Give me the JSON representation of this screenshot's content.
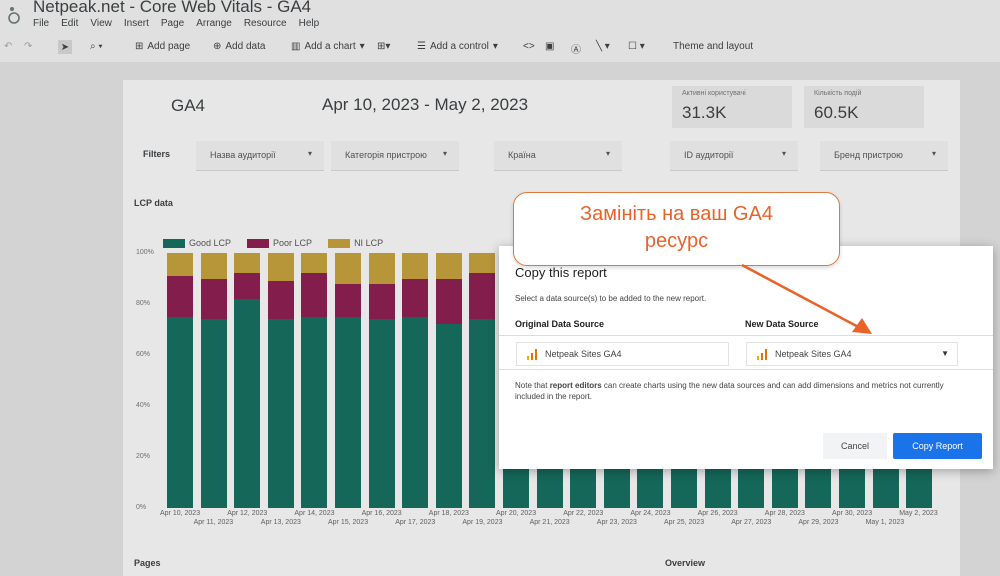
{
  "app": {
    "title": "Netpeak.net - Core Web Vitals - GA4",
    "menu": [
      "File",
      "Edit",
      "View",
      "Insert",
      "Page",
      "Arrange",
      "Resource",
      "Help"
    ]
  },
  "toolbar": {
    "add_page": "Add page",
    "add_data": "Add data",
    "add_chart": "Add a chart",
    "add_control": "Add a control",
    "theme_layout": "Theme and layout"
  },
  "report": {
    "ga4_label": "GA4",
    "date_range": "Apr 10, 2023 - May 2, 2023",
    "scorecards": [
      {
        "label": "Активні користувачі",
        "value": "31.3K"
      },
      {
        "label": "Кількість подій",
        "value": "60.5K"
      }
    ],
    "filters_label": "Filters",
    "filters": [
      "Назва аудиторії",
      "Категорія пристрою",
      "Країна",
      "ID аудиторії",
      "Бренд пристрою"
    ],
    "lcp_section": "LCP data",
    "pages_section": "Pages",
    "overview_section": "Overview"
  },
  "chart_data": {
    "type": "bar",
    "stacked": true,
    "legend": [
      "Good LCP",
      "Poor LCP",
      "NI LCP"
    ],
    "colors": {
      "good": "#0f6e5e",
      "poor": "#8e1a4f",
      "ni": "#c9a23a"
    },
    "y_ticks": [
      "100%",
      "80%",
      "60%",
      "40%",
      "20%",
      "0%"
    ],
    "ylim": [
      0,
      100
    ],
    "categories": [
      "Apr 10, 2023",
      "Apr 11, 2023",
      "Apr 12, 2023",
      "Apr 13, 2023",
      "Apr 14, 2023",
      "Apr 15, 2023",
      "Apr 16, 2023",
      "Apr 17, 2023",
      "Apr 18, 2023",
      "Apr 19, 2023",
      "Apr 20, 2023",
      "Apr 21, 2023",
      "Apr 22, 2023",
      "Apr 23, 2023",
      "Apr 24, 2023",
      "Apr 25, 2023",
      "Apr 26, 2023",
      "Apr 27, 2023",
      "Apr 28, 2023",
      "Apr 29, 2023",
      "Apr 30, 2023",
      "May 1, 2023",
      "May 2, 2023"
    ],
    "series": [
      {
        "name": "Good LCP",
        "values": [
          75,
          74,
          82,
          74,
          75,
          75,
          74,
          75,
          72,
          74,
          76,
          75,
          76,
          77,
          75,
          76,
          77,
          76,
          75,
          76,
          74,
          75,
          73
        ]
      },
      {
        "name": "Poor LCP",
        "values": [
          16,
          16,
          10,
          15,
          17,
          13,
          14,
          15,
          18,
          18,
          15,
          16,
          15,
          14,
          16,
          15,
          14,
          15,
          16,
          15,
          17,
          16,
          17
        ]
      },
      {
        "name": "NI LCP",
        "values": [
          9,
          10,
          8,
          11,
          8,
          12,
          12,
          10,
          10,
          8,
          9,
          9,
          9,
          9,
          9,
          9,
          9,
          9,
          9,
          9,
          9,
          9,
          10
        ]
      }
    ]
  },
  "dialog": {
    "title": "Copy this report",
    "subtitle": "Select a data source(s) to be added to the new report.",
    "original_header": "Original Data Source",
    "new_header": "New Data Source",
    "original_source": "Netpeak Sites GA4",
    "new_source": "Netpeak Sites GA4",
    "note_prefix": "Note that ",
    "note_bold": "report editors",
    "note_suffix": " can create charts using the new data sources and can add dimensions and metrics not currently included in the report.",
    "cancel": "Cancel",
    "copy": "Copy Report"
  },
  "callout": {
    "line1": "Замініть на ваш GA4",
    "line2": "ресурс",
    "color": "#e8632a"
  }
}
